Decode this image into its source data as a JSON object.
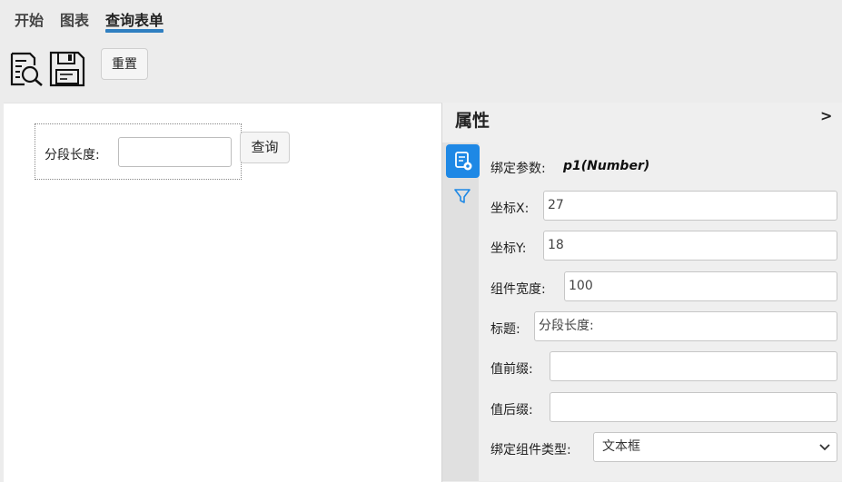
{
  "menu": {
    "tabs": [
      {
        "label": "开始"
      },
      {
        "label": "图表"
      },
      {
        "label": "查询表单",
        "active": true
      }
    ]
  },
  "toolbar": {
    "preview_icon": "search-document-icon",
    "save_icon": "save-icon",
    "reset_label": "重置"
  },
  "canvas": {
    "widget_label": "分段长度:",
    "widget_input_value": "",
    "query_button_label": "查询"
  },
  "panel": {
    "title": "属性",
    "collapse_label": ">",
    "side_tabs": [
      {
        "icon": "params-icon",
        "active": true
      },
      {
        "icon": "filter-icon",
        "active": false
      }
    ],
    "bind_param_label": "绑定参数:",
    "bind_param_value": "p1(Number)",
    "fields": {
      "x_label": "坐标X:",
      "x_value": "27",
      "y_label": "坐标Y:",
      "y_value": "18",
      "width_label": "组件宽度:",
      "width_value": "100",
      "title_label": "标题:",
      "title_value": "分段长度:",
      "prefix_label": "值前缀:",
      "prefix_value": "",
      "suffix_label": "值后缀:",
      "suffix_value": "",
      "type_label": "绑定组件类型:",
      "type_value": "文本框"
    }
  },
  "colors": {
    "accent": "#1e88e5",
    "underline": "#2f7fc1"
  }
}
